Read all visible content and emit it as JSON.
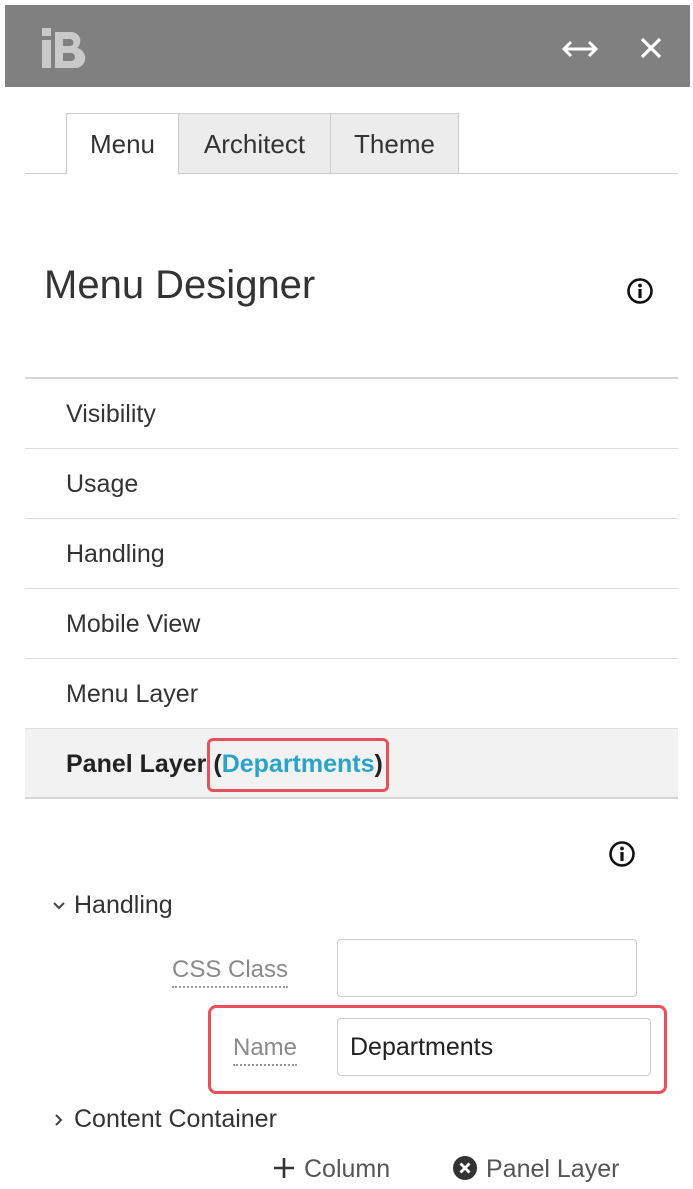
{
  "titlebar": {
    "logo_icon": "ib-logo-icon",
    "expand_icon": "resize-horizontal-icon",
    "close_icon": "close-icon"
  },
  "tabs": [
    {
      "label": "Menu",
      "active": true
    },
    {
      "label": "Architect",
      "active": false
    },
    {
      "label": "Theme",
      "active": false
    }
  ],
  "page_title": "Menu Designer",
  "menu_items": [
    "Visibility",
    "Usage",
    "Handling",
    "Mobile View",
    "Menu Layer"
  ],
  "panel_layer": {
    "label": "Panel Layer",
    "open_paren": "(",
    "link": "Departments",
    "close_paren": ")"
  },
  "handling_section": {
    "title": "Handling",
    "css_class_label": "CSS Class",
    "css_class_value": "",
    "name_label": "Name",
    "name_value": "Departments"
  },
  "content_container": {
    "title": "Content Container"
  },
  "actions": {
    "add_column": "Column",
    "remove_panel_layer": "Panel Layer"
  },
  "colors": {
    "titlebar": "#808080",
    "accent_link": "#2aa3c9",
    "highlight": "#e8505b"
  }
}
